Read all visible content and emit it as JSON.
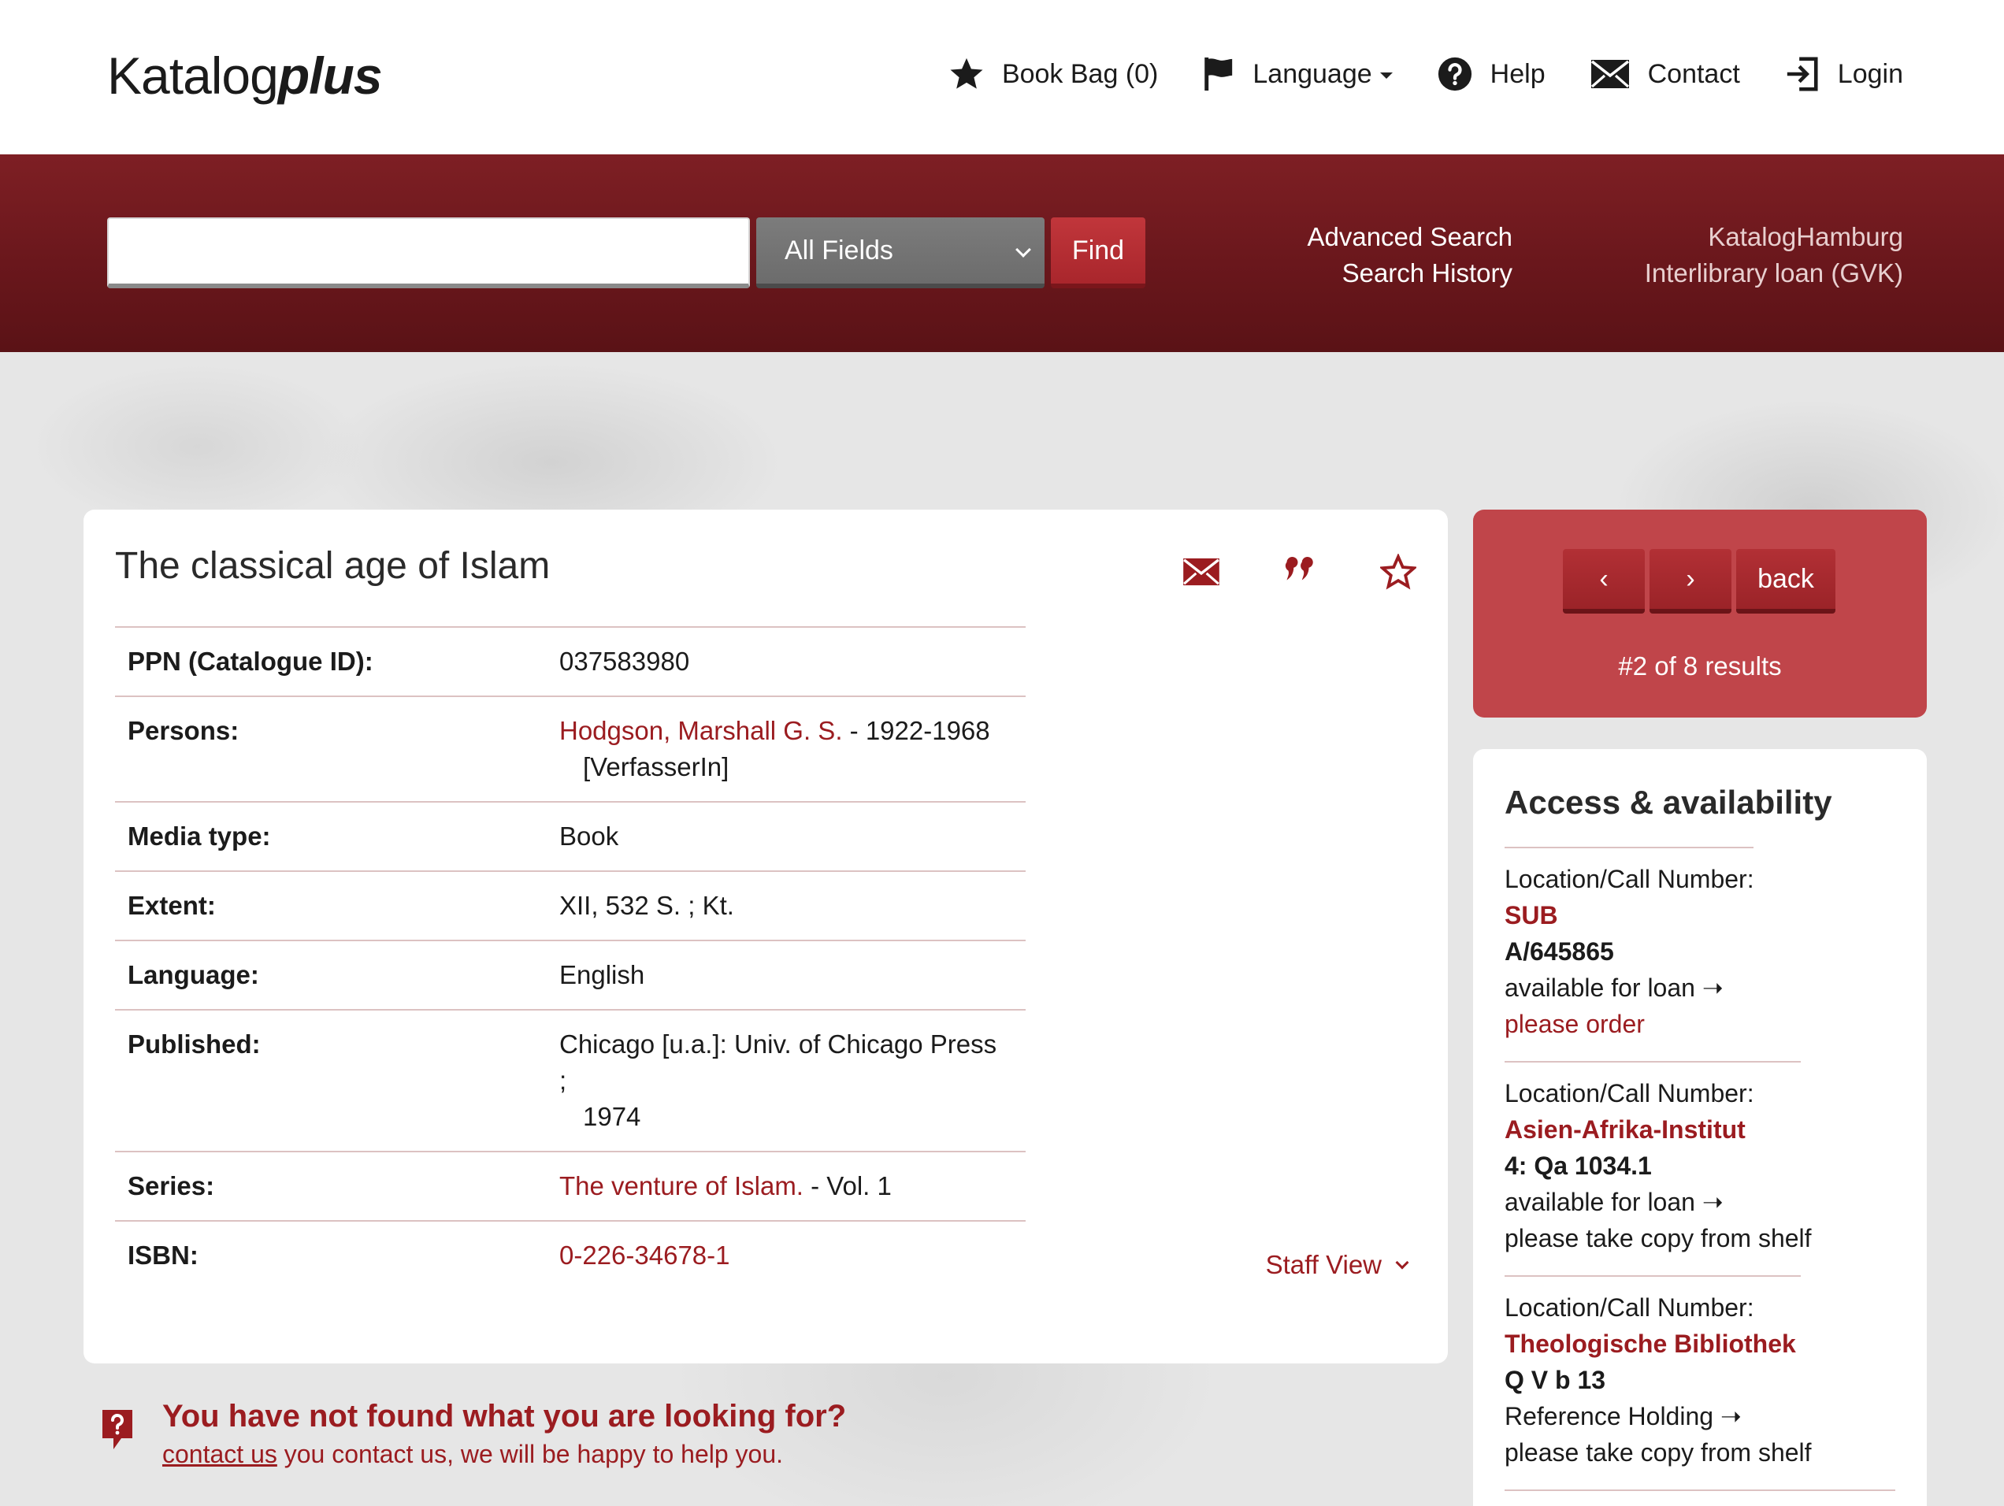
{
  "header": {
    "logo_main": "Katalog",
    "logo_plus": "plus",
    "nav": {
      "book_bag": "Book Bag (0)",
      "language": "Language",
      "help": "Help",
      "contact": "Contact",
      "login": "Login"
    }
  },
  "search": {
    "query": "",
    "field_select": "All Fields",
    "find_label": "Find",
    "advanced_search": "Advanced Search",
    "search_history": "Search History",
    "katalog_hamburg": "KatalogHamburg",
    "interlibrary_loan": "Interlibrary loan (GVK)"
  },
  "record": {
    "title": "The classical age of Islam",
    "rows": [
      {
        "label": "PPN (Catalogue ID):",
        "value": "037583980"
      },
      {
        "label": "Persons:",
        "link": "Hodgson, Marshall G. S.",
        "value": " - 1922-1968",
        "cont": "[VerfasserIn]"
      },
      {
        "label": "Media type:",
        "value": "Book"
      },
      {
        "label": "Extent:",
        "value": "XII, 532 S. ; Kt."
      },
      {
        "label": "Language:",
        "value": "English"
      },
      {
        "label": "Published:",
        "value": "Chicago [u.a.]: Univ. of Chicago Press ;",
        "cont": "1974"
      },
      {
        "label": "Series:",
        "link": "The venture of Islam.",
        "value": " - Vol. 1"
      },
      {
        "label": "ISBN:",
        "link": "0-226-34678-1"
      }
    ],
    "staff_view": "Staff View"
  },
  "notfound": {
    "title": "You have not found what you are looking for?",
    "link": "contact us",
    "text": " you contact us, we will be happy to help you."
  },
  "result_nav": {
    "prev": "‹",
    "next": "›",
    "back": "back",
    "count": "#2 of 8 results"
  },
  "availability": {
    "title": "Access & availability",
    "holdings": [
      {
        "label": "Location/Call Number:",
        "library": "SUB",
        "call_number": "A/645865",
        "status": "available for loan ➝",
        "action": "please order",
        "action_link": true
      },
      {
        "label": "Location/Call Number:",
        "library": "Asien-Afrika-Institut",
        "call_number": "4: Qa 1034.1",
        "status": "available for loan ➝",
        "action": "please take copy from shelf",
        "action_link": false
      },
      {
        "label": "Location/Call Number:",
        "library": "Theologische Bibliothek",
        "call_number": "Q V b 13",
        "status": "Reference Holding ➝",
        "action": "please take copy from shelf",
        "action_link": false
      }
    ]
  },
  "colors": {
    "brand_red": "#9b1c20",
    "header_band": "#6a171c",
    "nav_panel": "#c0454a"
  }
}
